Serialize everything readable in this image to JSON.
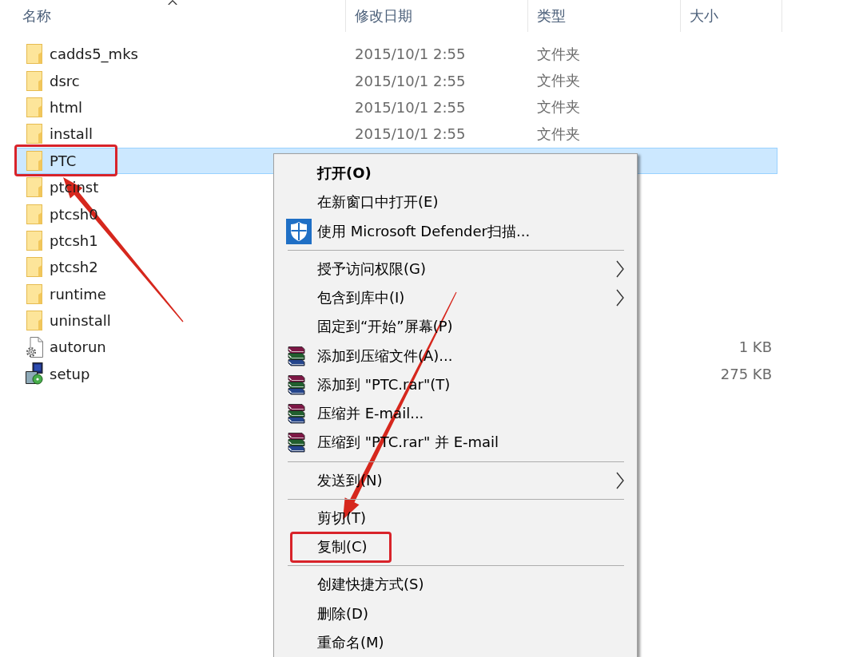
{
  "file_list": {
    "columns": [
      {
        "label": "名称",
        "sorted": true
      },
      {
        "label": "修改日期",
        "sorted": false
      },
      {
        "label": "类型",
        "sorted": false
      },
      {
        "label": "大小",
        "sorted": false
      }
    ],
    "rows": [
      {
        "kind": "folder",
        "name": "cadds5_mks",
        "date": "2015/10/1 2:55",
        "type": "文件夹",
        "selected": false,
        "callout": false
      },
      {
        "kind": "folder",
        "name": "dsrc",
        "date": "2015/10/1 2:55",
        "type": "文件夹",
        "selected": false,
        "callout": false
      },
      {
        "kind": "folder",
        "name": "html",
        "date": "2015/10/1 2:55",
        "type": "文件夹",
        "selected": false,
        "callout": false
      },
      {
        "kind": "folder",
        "name": "install",
        "date": "2015/10/1 2:55",
        "type": "文件夹",
        "selected": false,
        "callout": false
      },
      {
        "kind": "folder",
        "name": "PTC",
        "selected": true,
        "callout": true
      },
      {
        "kind": "folder",
        "name": "ptcinst",
        "selected": false,
        "callout": false
      },
      {
        "kind": "folder",
        "name": "ptcsh0",
        "selected": false,
        "callout": false
      },
      {
        "kind": "folder",
        "name": "ptcsh1",
        "selected": false,
        "callout": false
      },
      {
        "kind": "folder",
        "name": "ptcsh2",
        "selected": false,
        "callout": false
      },
      {
        "kind": "folder",
        "name": "runtime",
        "selected": false,
        "callout": false
      },
      {
        "kind": "folder",
        "name": "uninstall",
        "selected": false,
        "callout": false
      },
      {
        "kind": "settings-file",
        "name": "autorun",
        "size": "1 KB",
        "selected": false,
        "callout": false
      },
      {
        "kind": "installer",
        "name": "setup",
        "size": "275 KB",
        "selected": false,
        "callout": false
      }
    ]
  },
  "context_menu": {
    "items": [
      {
        "kind": "command",
        "label": "打开(O)",
        "default": true,
        "submenu": false,
        "callout": false
      },
      {
        "kind": "command",
        "label": "在新窗口中打开(E)",
        "default": false,
        "submenu": false,
        "callout": false
      },
      {
        "kind": "scan",
        "label": "使用 Microsoft Defender扫描...",
        "default": false,
        "submenu": false,
        "callout": false
      },
      {
        "kind": "separator"
      },
      {
        "kind": "command",
        "label": "授予访问权限(G)",
        "default": false,
        "submenu": true,
        "callout": false
      },
      {
        "kind": "command",
        "label": "包含到库中(I)",
        "default": false,
        "submenu": true,
        "callout": false
      },
      {
        "kind": "command",
        "label": "固定到“开始”屏幕(P)",
        "default": false,
        "submenu": false,
        "callout": false
      },
      {
        "kind": "archive",
        "label": "添加到压缩文件(A)...",
        "default": false,
        "submenu": false,
        "callout": false
      },
      {
        "kind": "archive",
        "label": "添加到 \"PTC.rar\"(T)",
        "default": false,
        "submenu": false,
        "callout": false
      },
      {
        "kind": "archive",
        "label": "压缩并 E-mail...",
        "default": false,
        "submenu": false,
        "callout": false
      },
      {
        "kind": "archive",
        "label": "压缩到 \"PTC.rar\" 并 E-mail",
        "default": false,
        "submenu": false,
        "callout": false
      },
      {
        "kind": "separator"
      },
      {
        "kind": "command",
        "label": "发送到(N)",
        "default": false,
        "submenu": true,
        "callout": false
      },
      {
        "kind": "separator"
      },
      {
        "kind": "command",
        "label": "剪切(T)",
        "default": false,
        "submenu": false,
        "callout": false
      },
      {
        "kind": "command",
        "label": "复制(C)",
        "default": false,
        "submenu": false,
        "callout": true
      },
      {
        "kind": "separator"
      },
      {
        "kind": "command",
        "label": "创建快捷方式(S)",
        "default": false,
        "submenu": false,
        "callout": false
      },
      {
        "kind": "command",
        "label": "删除(D)",
        "default": false,
        "submenu": false,
        "callout": false
      },
      {
        "kind": "command",
        "label": "重命名(M)",
        "default": false,
        "submenu": false,
        "callout": false
      }
    ]
  }
}
